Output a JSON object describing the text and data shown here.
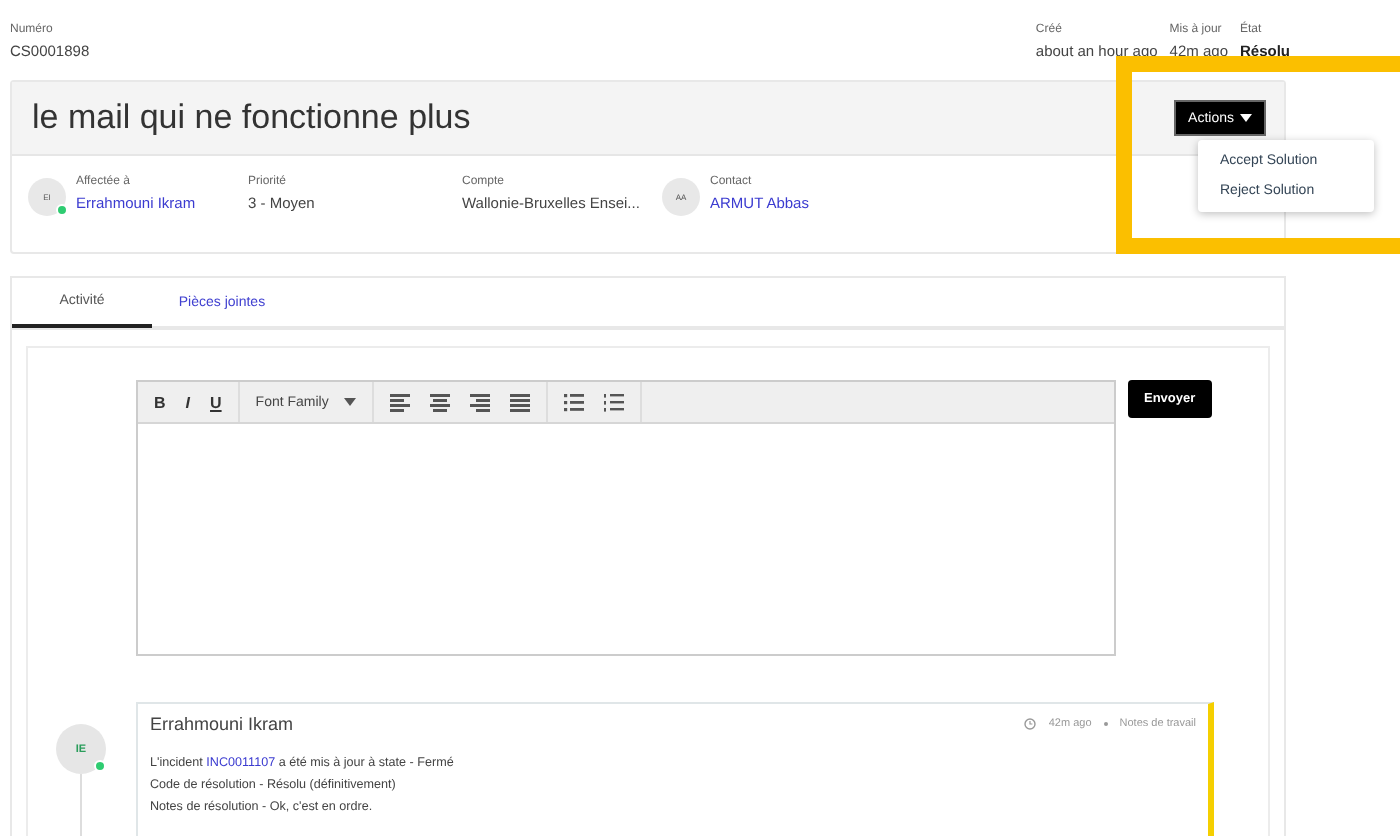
{
  "header": {
    "number": {
      "label": "Numéro",
      "value": "CS0001898"
    },
    "right_fields": [
      {
        "label": "Créé",
        "value": "about an hour ago",
        "kind": "plain"
      },
      {
        "label": "Mis à jour",
        "value": "42m ago",
        "kind": "plain"
      },
      {
        "label": "État",
        "value": "Résolu",
        "kind": "strong"
      }
    ]
  },
  "case": {
    "title": "le mail qui ne fonctionne plus",
    "actions_button": "Actions",
    "menu": [
      {
        "label": "Accept Solution"
      },
      {
        "label": "Reject Solution"
      }
    ],
    "info": [
      {
        "kind": "person",
        "label": "Affectée à",
        "value": "Errahmouni Ikram",
        "initials": "EI",
        "online": true
      },
      {
        "kind": "text",
        "label": "Priorité",
        "value": "3 - Moyen"
      },
      {
        "kind": "text",
        "label": "Compte",
        "value": "Wallonie-Bruxelles Ensei..."
      },
      {
        "kind": "person",
        "label": "Contact",
        "value": "ARMUT Abbas",
        "initials": "AA",
        "online": false
      }
    ]
  },
  "tabs": [
    {
      "label": "Activité",
      "selected": true
    },
    {
      "label": "Pièces jointes",
      "selected": false
    }
  ],
  "editor": {
    "toolbar": [
      {
        "kind": "bold",
        "label": "B"
      },
      {
        "kind": "italic",
        "label": "I"
      },
      {
        "kind": "underline",
        "label": "U"
      },
      {
        "kind": "font",
        "label": "Font Family"
      },
      {
        "kind": "align-left"
      },
      {
        "kind": "align-center"
      },
      {
        "kind": "align-right"
      },
      {
        "kind": "justify"
      },
      {
        "kind": "bullet-list"
      },
      {
        "kind": "number-list"
      }
    ],
    "send_button": "Envoyer"
  },
  "activity": [
    {
      "initials": "IE",
      "online": true,
      "author": "Errahmouni Ikram",
      "time": "42m ago",
      "type": "Notes de travail",
      "lines": [
        {
          "text": "L'incident ",
          "link": "INC0011107",
          "rest": " a été mis à jour à state - Fermé"
        },
        {
          "text": "Code de résolution - Résolu (définitivement)"
        },
        {
          "text": "Notes de résolution - Ok, c'est en ordre."
        }
      ]
    }
  ]
}
